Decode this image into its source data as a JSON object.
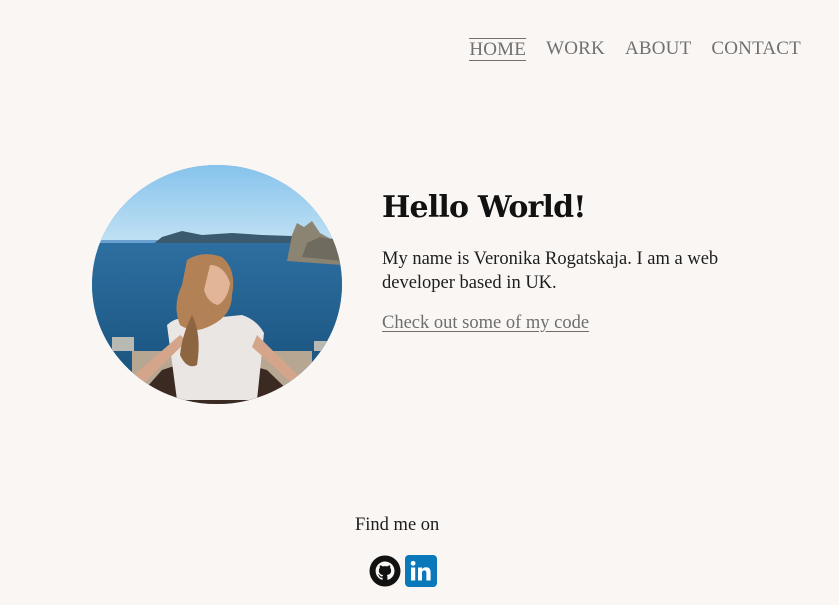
{
  "nav": {
    "items": [
      {
        "label": "HOME",
        "active": true
      },
      {
        "label": "WORK",
        "active": false
      },
      {
        "label": "ABOUT",
        "active": false
      },
      {
        "label": "CONTACT",
        "active": false
      }
    ]
  },
  "hero": {
    "heading": "Hello World!",
    "description": "My name is Veronika Rogatskaja. I am a web developer based in UK.",
    "link_text": "Check out some of my code"
  },
  "footer": {
    "find_me": "Find me on",
    "social": [
      {
        "icon": "github-icon"
      },
      {
        "icon": "linkedin-icon",
        "color": "#0a79b9"
      }
    ]
  },
  "colors": {
    "background": "#faf6f4",
    "nav_text": "#707070",
    "link": "#6e6e6e"
  }
}
